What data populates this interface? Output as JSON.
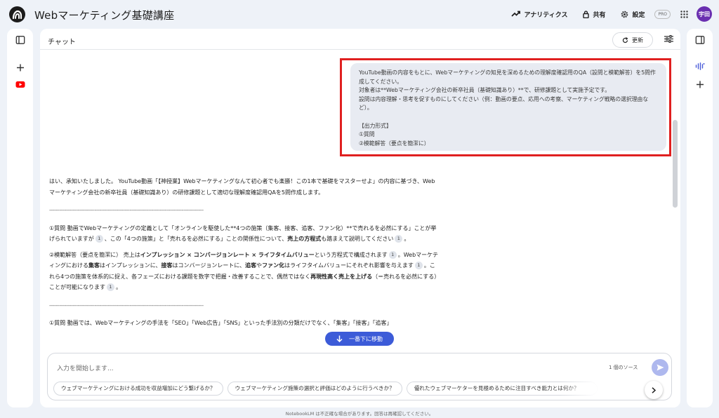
{
  "app": {
    "title": "Webマーケティング基礎講座"
  },
  "topbar": {
    "analytics_label": "アナリティクス",
    "share_label": "共有",
    "settings_label": "設定",
    "pro_badge": "PRO",
    "avatar_initials": "宇田"
  },
  "chat": {
    "title": "チャット",
    "refresh_label": "更新"
  },
  "user_message": {
    "lines": "YouTube動画の内容をもとに、Webマーケティングの知見を深めるための理解度確認用のQA（設問と模範解答）を5問作成してください。\n対象者は**Webマーケティング会社の新卒社員（基礎知識あり）**で、研修課題として実施予定です。\n設問は内容理解・思考を促すものにしてください（例：動画の要点、応用への考察、マーケティング戦略の選択理由など）。\n\n【出力形式】\n①質問\n②模範解答（要点を簡潔に）"
  },
  "answer": {
    "intro": "はい、承知いたしました。 YouTube動画「【神授業】Webマーケティングなんて初心者でも楽勝！この1本で基礎をマスターせよ」の内容に基づき、Webマーケティング会社の新卒社員（基礎知識あり）の研修課題として適切な理解度確認用QAを5問作成します。",
    "divider": "--------------------------------------------------------------------------------------------",
    "q1_part1": "①質問 動画でWebマーケティングの定義として「オンラインを駆使した**4つの施策（集客、接客、追客、ファン化）**で売れるを必然にする」ことが挙げられていますが",
    "q1_part2": "、この「4つの施策」と「売れるを必然にする」ことの関係性について、",
    "q1_bold": "売上の方程式",
    "q1_part3": "も踏まえて説明してください",
    "a1_pre": "②模範解答（要点を簡潔に） 売上は",
    "a1_bold1": "インプレッション × コンバージョンレート × ライフタイムバリュー",
    "a1_mid1": "という方程式で構成されます",
    "a1_mid2": "。Webマーケティングにおける",
    "a1_bold2": "集客",
    "a1_mid3": "はインプレッションに、",
    "a1_bold3": "接客",
    "a1_mid4": "はコンバージョンレートに、",
    "a1_bold4": "追客",
    "a1_mid5": "や",
    "a1_bold5": "ファン化",
    "a1_mid6": "はライフタイムバリューにそれぞれ影響を与えます",
    "a1_mid7": "。これら4つの施策を体系的に捉え、各フェーズにおける課題を数字で把握・改善することで、偶然ではなく",
    "a1_bold6": "再現性高く売上を上げる",
    "a1_end": "（＝売れるを必然にする）ことが可能になります",
    "divider2": "--------------------------------------------------------------------------------------------",
    "q2": "①質問 動画では、Webマーケティングの手法を「SEO」「Web広告」「SNS」といった手法別の分類だけでなく、「集客」「接客」「追客」",
    "cite_label": "1"
  },
  "jump_button": {
    "label": "一番下に移動"
  },
  "composer": {
    "placeholder": "入力を開始します...",
    "source_count": "1 個のソース"
  },
  "suggestions": [
    "ウェブマーケティングにおける成功を収益増加にどう繋げるか？",
    "ウェブマーケティング施策の選択と評価はどのように行うべきか？",
    "優れたウェブマーケターを見極めるために注目すべき能力とは何か？"
  ],
  "footer": {
    "note": "NotebookLM は不正確な場合があります。回答は再確認してください。"
  }
}
